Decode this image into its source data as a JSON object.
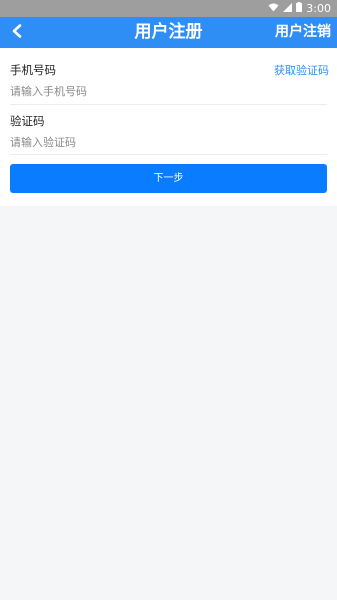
{
  "status_bar": {
    "time": "3:00",
    "icons": [
      "wifi-icon",
      "signal-icon",
      "battery-icon"
    ]
  },
  "title_bar": {
    "back_icon": "chevron-left-icon",
    "title": "用户注册",
    "right_action": "用户注销"
  },
  "form": {
    "phone": {
      "label": "手机号码",
      "placeholder": "请输入手机号码",
      "value": ""
    },
    "get_code": "获取验证码",
    "code": {
      "label": "验证码",
      "placeholder": "请输入验证码",
      "value": ""
    },
    "next_button": "下一步"
  },
  "colors": {
    "accent": "#2f8ef5",
    "button": "#0a7cff",
    "status_bar": "#9e9e9e",
    "background": "#f5f6f8"
  }
}
